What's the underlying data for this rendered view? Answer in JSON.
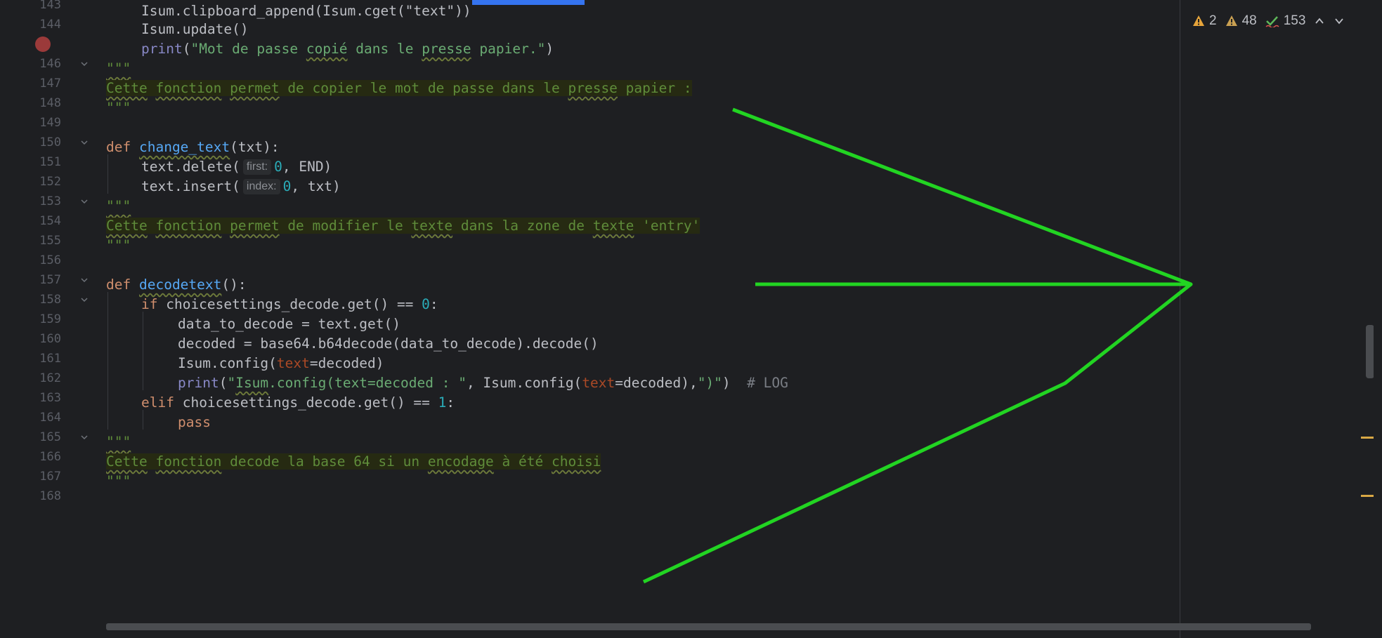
{
  "status": {
    "warn1_count": "2",
    "warn2_count": "48",
    "typo_count": "153"
  },
  "lines": [
    {
      "num": "143",
      "text": "Isum.clipboard_append(Isum.cget(\"text\"))"
    },
    {
      "num": "144",
      "text": "Isum.update()"
    },
    {
      "num": "145",
      "text": "print(\"Mot de passe copié dans le presse papier.\")",
      "breakpoint": true
    },
    {
      "num": "146",
      "text": "\"\"\""
    },
    {
      "num": "147",
      "text": "Cette fonction permet de copier le mot de passe dans le presse papier :"
    },
    {
      "num": "148",
      "text": "\"\"\""
    },
    {
      "num": "149",
      "text": ""
    },
    {
      "num": "150",
      "text": "def change_text(txt):"
    },
    {
      "num": "151",
      "text": "text.delete( first: 0, END)"
    },
    {
      "num": "152",
      "text": "text.insert( index: 0, txt)"
    },
    {
      "num": "153",
      "text": "\"\"\""
    },
    {
      "num": "154",
      "text": "Cette fonction permet de modifier le texte dans la zone de texte 'entry'"
    },
    {
      "num": "155",
      "text": "\"\"\""
    },
    {
      "num": "156",
      "text": ""
    },
    {
      "num": "157",
      "text": "def decodetext():"
    },
    {
      "num": "158",
      "text": "if choicesettings_decode.get() == 0:"
    },
    {
      "num": "159",
      "text": "data_to_decode = text.get()"
    },
    {
      "num": "160",
      "text": "decoded = base64.b64decode(data_to_decode).decode()"
    },
    {
      "num": "161",
      "text": "Isum.config(text=decoded)"
    },
    {
      "num": "162",
      "text": "print(\"Isum.config(text=decoded : \", Isum.config(text=decoded),\")\")  # LOG"
    },
    {
      "num": "163",
      "text": "elif choicesettings_decode.get() == 1:"
    },
    {
      "num": "164",
      "text": "pass"
    },
    {
      "num": "165",
      "text": "\"\"\""
    },
    {
      "num": "166",
      "text": "Cette fonction decode la base 64 si un encodage à été choisi"
    },
    {
      "num": "167",
      "text": "\"\"\""
    },
    {
      "num": "168",
      "text": ""
    }
  ],
  "colors": {
    "annotation": "#22d422",
    "docstring_bg": "#262a12",
    "keyword": "#cf8e6d",
    "function": "#56a8f5",
    "string": "#6aab73",
    "number": "#2aacb8"
  }
}
